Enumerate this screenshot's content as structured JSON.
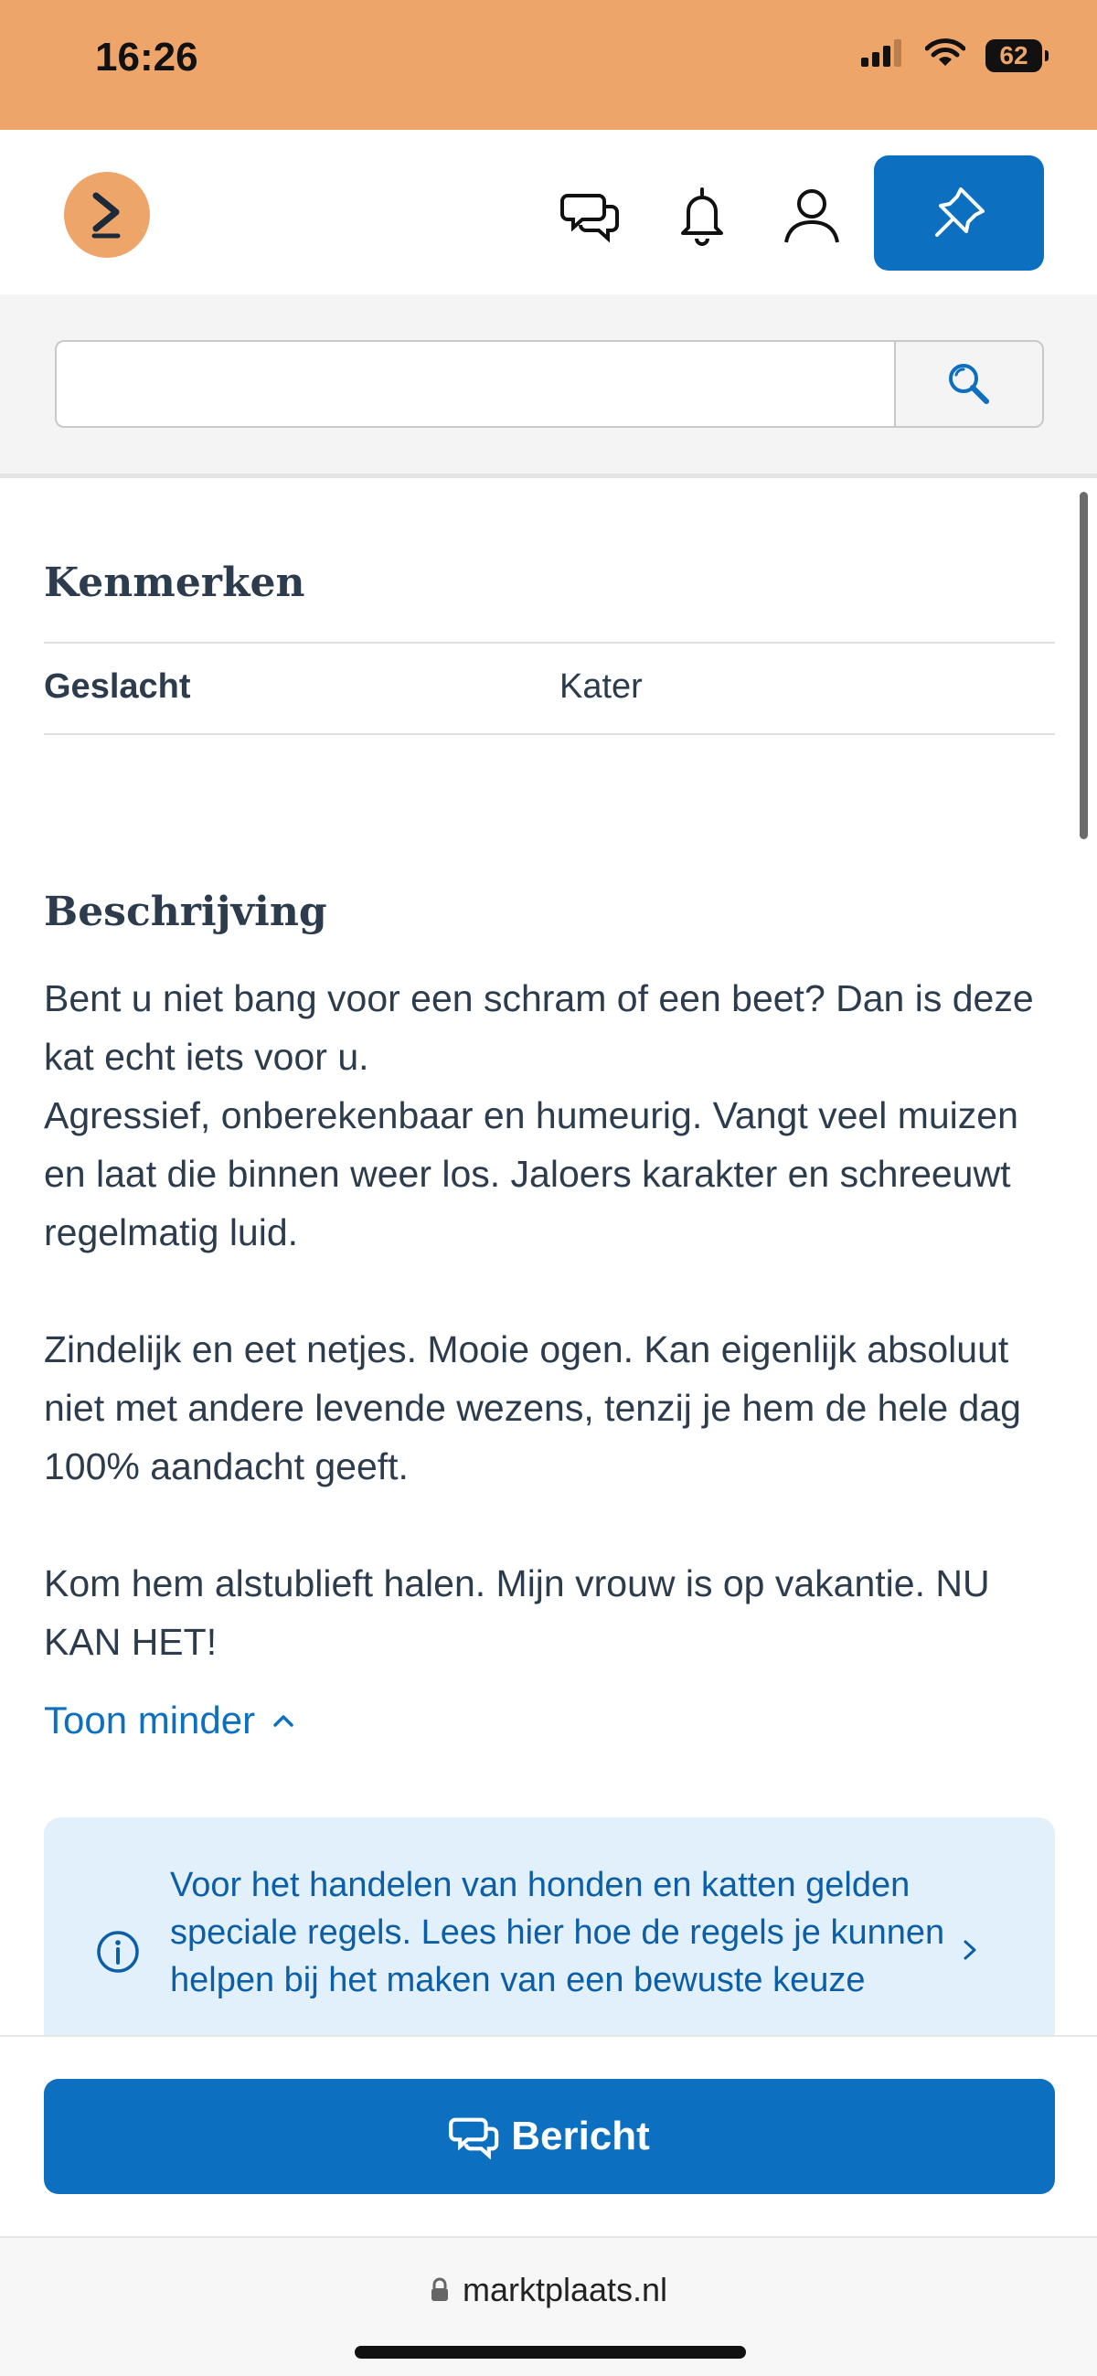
{
  "status": {
    "time": "16:26",
    "battery": "62"
  },
  "header": {
    "icons": [
      "chat-icon",
      "bell-icon",
      "user-icon",
      "pin-icon"
    ]
  },
  "search": {
    "value": "",
    "placeholder": ""
  },
  "kenmerken": {
    "title": "Kenmerken",
    "rows": [
      {
        "label": "Geslacht",
        "value": "Kater"
      }
    ]
  },
  "beschrijving": {
    "title": "Beschrijving",
    "paragraphs": [
      "Bent u niet bang voor een schram of een beet? Dan is deze kat echt iets voor u.",
      "Agressief, onberekenbaar en humeurig. Vangt veel muizen en laat die binnen weer los. Jaloers karakter en schreeuwt regelmatig luid.",
      "Zindelijk en eet netjes. Mooie ogen. Kan eigenlijk absoluut niet met andere levende wezens, tenzij je hem de hele dag 100% aandacht geeft.",
      "Kom hem alstublieft halen. Mijn vrouw is op vakantie. NU KAN HET!"
    ],
    "toggle_label": "Toon minder"
  },
  "notice": {
    "text": "Voor het handelen van honden en katten gelden speciale regels. Lees hier hoe de regels je kunnen helpen bij het maken van een bewuste keuze"
  },
  "action": {
    "message_label": "Bericht"
  },
  "browser": {
    "url": "marktplaats.nl"
  },
  "colors": {
    "brand_orange": "#eda56a",
    "brand_blue": "#0c6fbf",
    "notice_bg": "#e1f0fa",
    "text": "#2d3c4d"
  }
}
